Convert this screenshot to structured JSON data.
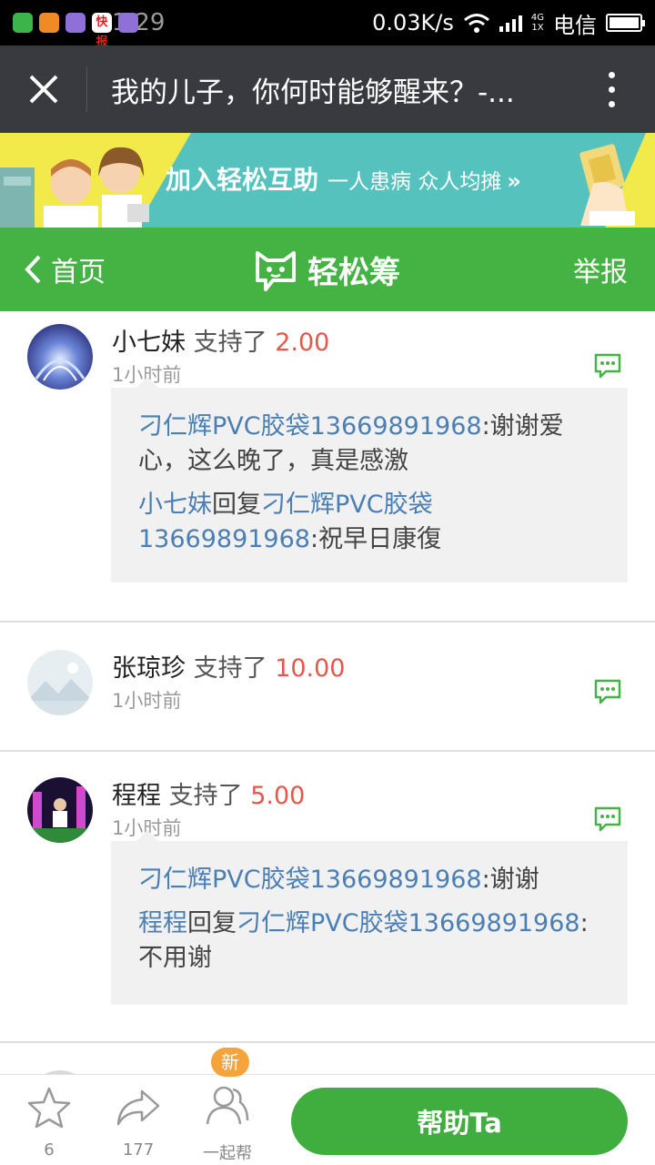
{
  "status_bar": {
    "time": "1:29",
    "speed": "0.03K/s",
    "network_top": "4G",
    "network_bottom": "1X",
    "carrier": "电信",
    "news_app_label": "快报"
  },
  "title_bar": {
    "title": "我的儿子，你何时能够醒来？-..."
  },
  "banner": {
    "headline": "加入轻松互助",
    "tagline": "一人患病  众人均摊",
    "chevron": "»"
  },
  "nav": {
    "back_label": "首页",
    "brand_name": "轻松筹",
    "report_label": "举报"
  },
  "feed": [
    {
      "name": "小七妹",
      "action": "支持了",
      "amount": "2.00",
      "time": "1小时前",
      "replies": [
        {
          "from": "刁仁辉PVC胶袋13669891968",
          "text": ":谢谢爱心，这么晚了，真是感激"
        },
        {
          "from": "小七妹",
          "verb": "回复",
          "to": "刁仁辉PVC胶袋13669891968",
          "text": ":祝早日康復"
        }
      ]
    },
    {
      "name": "张琼珍",
      "action": "支持了",
      "amount": "10.00",
      "time": "1小时前"
    },
    {
      "name": "程程",
      "action": "支持了",
      "amount": "5.00",
      "time": "1小时前",
      "replies": [
        {
          "from": "刁仁辉PVC胶袋13669891968",
          "text": ":谢谢"
        },
        {
          "from": "程程",
          "verb": "回复",
          "to": "刁仁辉PVC胶袋13669891968",
          "text": ":不用谢"
        }
      ]
    }
  ],
  "bottom_bar": {
    "favorite_count": "6",
    "share_count": "177",
    "together_label": "一起帮",
    "new_badge": "新",
    "help_button": "帮助Ta"
  },
  "colors": {
    "nav_green": "#45b344",
    "amount_red": "#e5574b",
    "link_blue": "#4a7fb5",
    "badge_orange": "#f4a43a"
  }
}
